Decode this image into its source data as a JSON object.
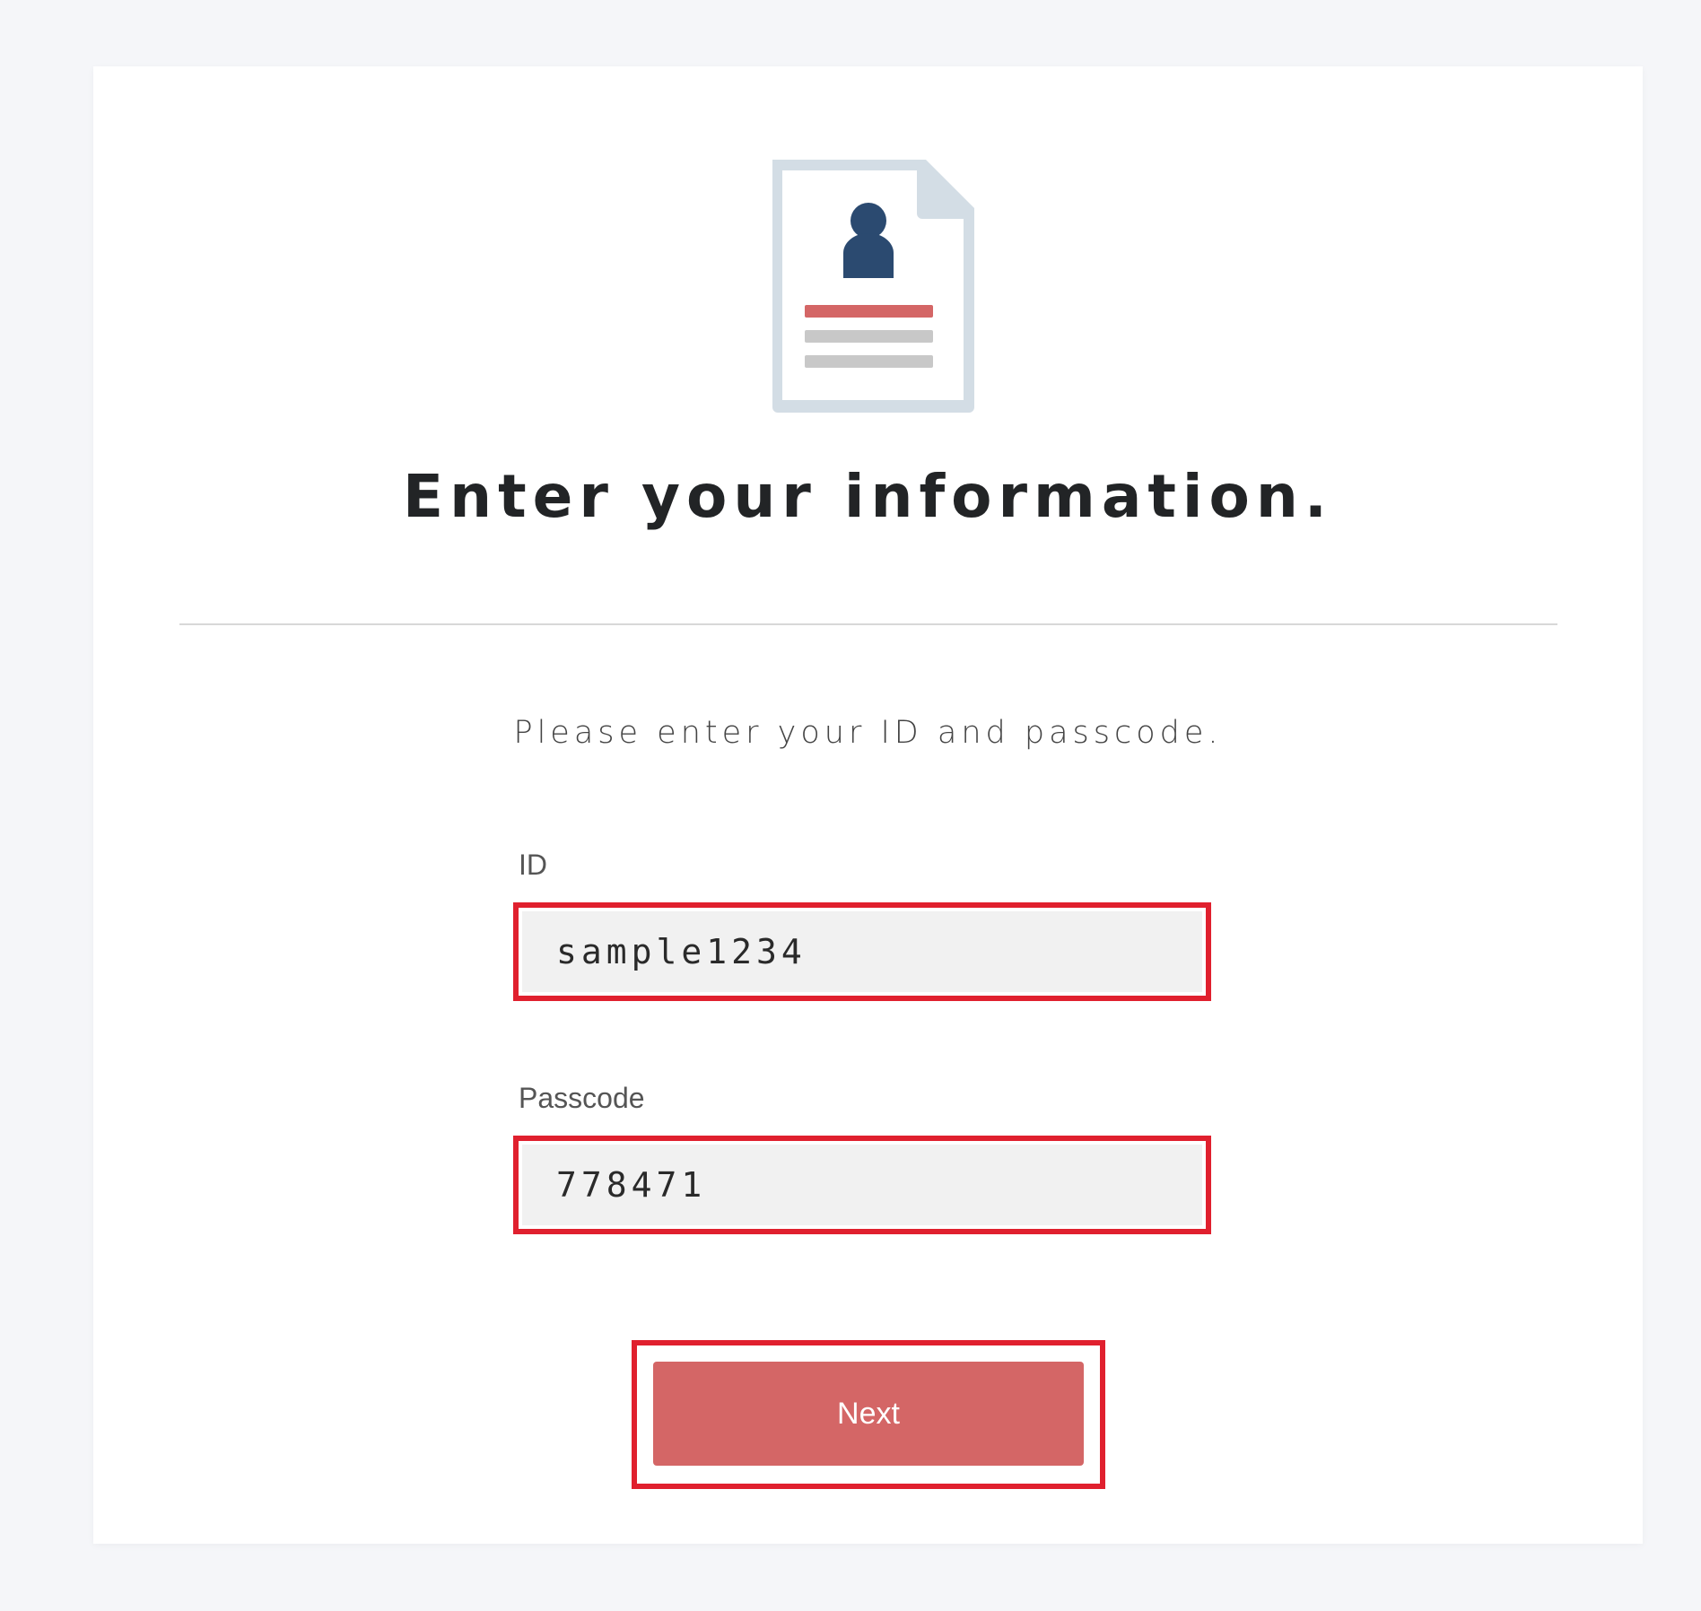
{
  "header": {
    "icon": "document-user-icon",
    "title": "Enter your information."
  },
  "form": {
    "instructions": "Please enter your ID and passcode.",
    "id_label": "ID",
    "id_value": "sample1234",
    "passcode_label": "Passcode",
    "passcode_value": "778471",
    "next_label": "Next"
  },
  "colors": {
    "accent": "#d46666",
    "highlight": "#e0202e",
    "icon_dark": "#2b4a70",
    "icon_frame": "#d3dde5"
  }
}
